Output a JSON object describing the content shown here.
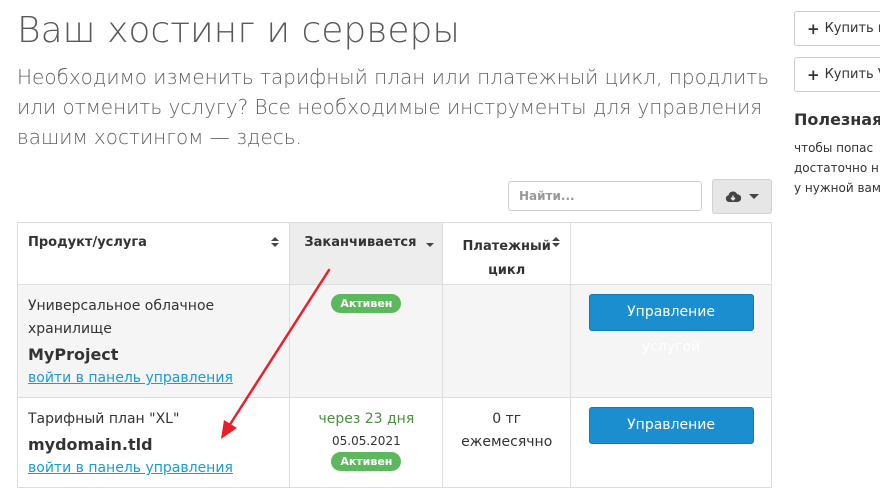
{
  "header": {
    "title": "Ваш хостинг и серверы",
    "description": "Необходимо изменить тарифный план или платежный цикл, продлить или отменить услугу? Все необходимые инструменты для управления вашим хостингом — здесь."
  },
  "toolbar": {
    "search_placeholder": "Найти...",
    "cloud_icon": "cloud-download-icon"
  },
  "table": {
    "columns": [
      "Продукт/услуга",
      "Заканчивается",
      "Платежный цикл",
      ""
    ],
    "rows": [
      {
        "group": "Универсальное облачное хранилище",
        "domain": "MyProject",
        "link": "войти в панель управления",
        "due_in": "",
        "due_date": "",
        "status": "Активен",
        "cycle_amount": "",
        "cycle_period": "",
        "action": "Управление услугой"
      },
      {
        "group": "Тарифный план \"XL\"",
        "domain": "mydomain.tld",
        "link": "войти в панель управления",
        "due_in": "через 23 дня",
        "due_date": "05.05.2021",
        "status": "Активен",
        "cycle_amount": "0 тг",
        "cycle_period": "ежемесячно",
        "action": "Управление услугой"
      }
    ]
  },
  "sidebar": {
    "buttons": [
      "Купить в",
      "Купить V"
    ],
    "title": "Полезная",
    "text_lines": [
      "чтобы попас",
      "достаточно н",
      "у нужной вам"
    ]
  },
  "colors": {
    "accent": "#1a8ecf",
    "link": "#1a9bd7",
    "status_active": "#5cb85c",
    "due_green": "#49903e",
    "annotation_arrow": "#e8202a"
  }
}
